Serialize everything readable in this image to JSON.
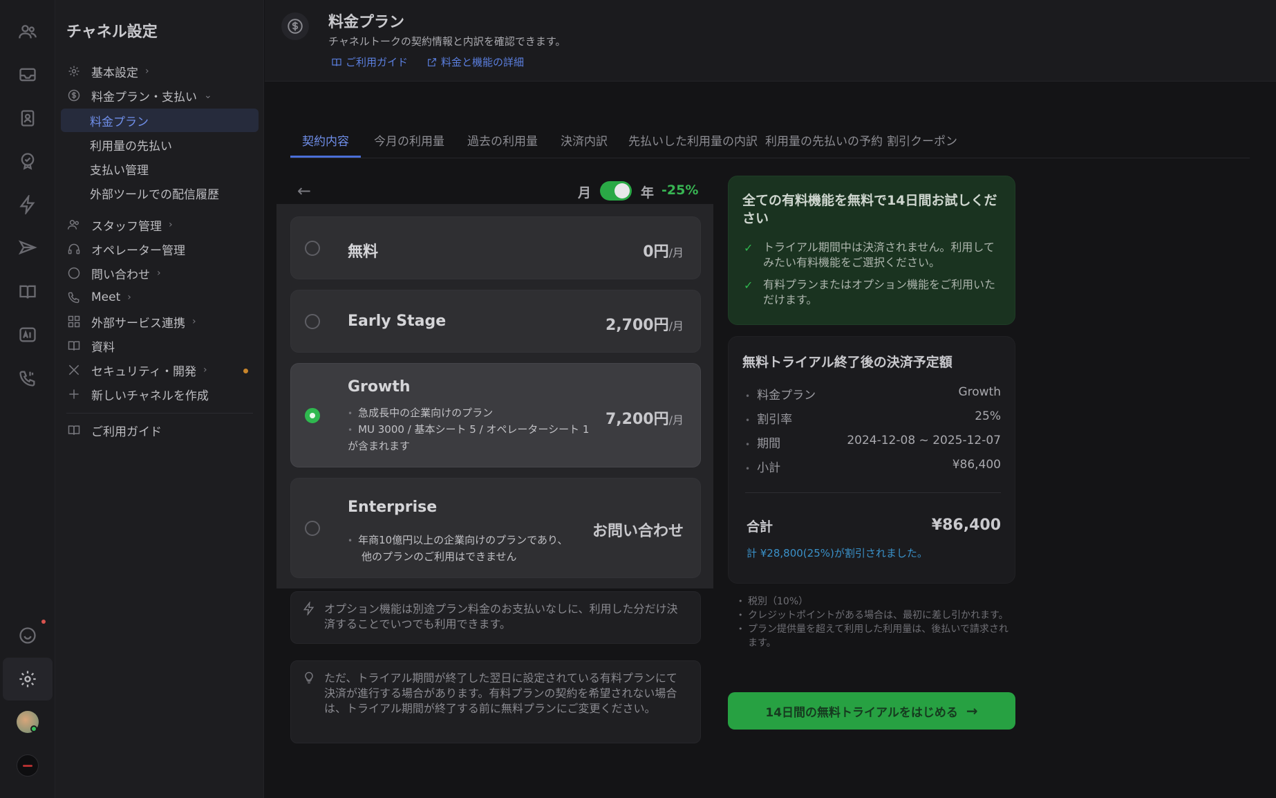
{
  "sidebar": {
    "title": "チャネル設定",
    "items": {
      "basic": "基本設定",
      "billing": "料金プラン・支払い",
      "billing_sub": [
        "料金プラン",
        "利用量の先払い",
        "支払い管理",
        "外部ツールでの配信履歴"
      ],
      "staff": "スタッフ管理",
      "operator": "オペレーター管理",
      "inquiry": "問い合わせ",
      "meet": "Meet",
      "external": "外部サービス連携",
      "docs": "資料",
      "security": "セキュリティ・開発",
      "new_channel": "新しいチャネルを作成",
      "guide": "ご利用ガイド"
    }
  },
  "header": {
    "title": "料金プラン",
    "subtitle": "チャネルトークの契約情報と内訳を確認できます。",
    "link_guide": "ご利用ガイド",
    "link_details": "料金と機能の詳細"
  },
  "tabs": [
    "契約内容",
    "今月の利用量",
    "過去の利用量",
    "決済内訳",
    "先払いした利用量の内訳",
    "利用量の先払いの予約",
    "割引クーポン"
  ],
  "billing_period": {
    "monthly": "月",
    "yearly": "年",
    "discount": "-25%",
    "yearly_selected": true
  },
  "plans": [
    {
      "name": "無料",
      "price": "0円",
      "unit": "/月",
      "selected": false
    },
    {
      "name": "Early Stage",
      "price": "2,700円",
      "unit": "/月",
      "selected": false
    },
    {
      "name": "Growth",
      "price": "7,200円",
      "unit": "/月",
      "selected": true,
      "desc1": "急成長中の企業向けのプラン",
      "desc2": "MU 3000 / 基本シート 5 / オペレーターシート 1",
      "desc3": "が含まれます"
    },
    {
      "name": "Enterprise",
      "price": "お問い合わせ",
      "unit": "",
      "selected": false,
      "desc1": "年商10億円以上の企業向けのプランであり、",
      "desc2": "他のプランのご利用はできません"
    }
  ],
  "notes": {
    "option": "オプション機能は別途プラン料金のお支払いなしに、利用した分だけ決済することでいつでも利用できます。",
    "trial_end": "ただ、トライアル期間が終了した翌日に設定されている有料プランにて決済が進行する場合があります。有料プランの契約を希望されない場合は、トライアル期間が終了する前に無料プランにご変更ください。"
  },
  "trial": {
    "title": "全ての有料機能を無料で14日間お試しください",
    "point1": "トライアル期間中は決済されません。利用してみたい有料機能をご選択ください。",
    "point2": "有料プランまたはオプション機能をご利用いただけます。"
  },
  "bill": {
    "title": "無料トライアル終了後の決済予定額",
    "rows": [
      {
        "k": "料金プラン",
        "v": "Growth"
      },
      {
        "k": "割引率",
        "v": "25%"
      },
      {
        "k": "期間",
        "v": "2024-12-08 ~ 2025-12-07"
      },
      {
        "k": "小計",
        "v": "¥86,400"
      }
    ],
    "total_label": "合計",
    "total_value": "¥86,400",
    "discount_note": "計 ¥28,800(25%)が割引されました。"
  },
  "tax_notes": [
    "税別（10%）",
    "クレジットポイントがある場合は、最初に差し引かれます。",
    "プラン提供量を超えて利用した利用量は、後払いで請求されます。"
  ],
  "cta": "14日間の無料トライアルをはじめる",
  "colors": {
    "accent": "#4a6ed8",
    "green": "#2fb84f",
    "warning": "#c8852b"
  }
}
